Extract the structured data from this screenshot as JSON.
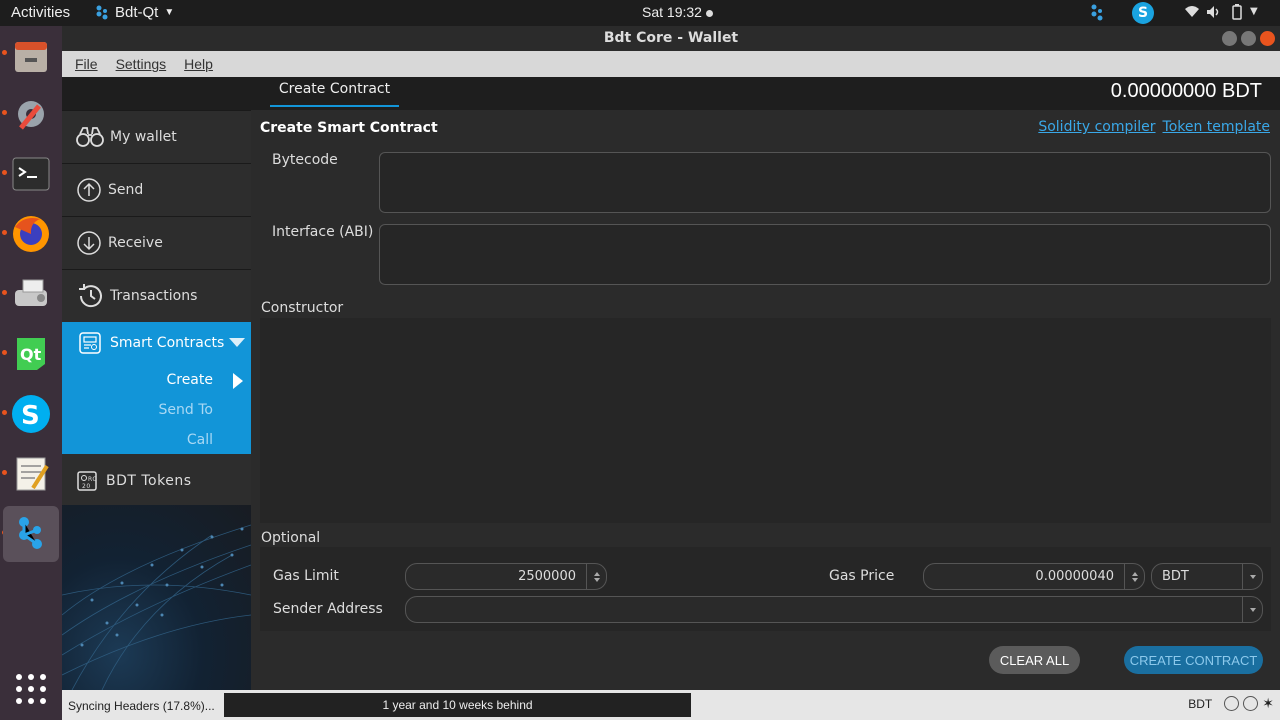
{
  "topbar": {
    "activities": "Activities",
    "app_menu": "Bdt-Qt",
    "clock": "Sat 19:32"
  },
  "window": {
    "title": "Bdt Core - Wallet"
  },
  "menubar": {
    "file": "File",
    "settings": "Settings",
    "help": "Help"
  },
  "sidebar": {
    "my_wallet": "My wallet",
    "send": "Send",
    "receive": "Receive",
    "transactions": "Transactions",
    "smart_contracts": "Smart Contracts",
    "sub_create": "Create",
    "sub_send_to": "Send To",
    "sub_call": "Call",
    "tokens": "BDT  Tokens"
  },
  "main": {
    "tab": "Create Contract",
    "balance": "0.00000000 BDT",
    "heading": "Create Smart Contract",
    "link_compiler": "Solidity compiler",
    "link_template": "Token template",
    "bytecode_label": "Bytecode",
    "abi_label": "Interface (ABI)",
    "constructor_label": "Constructor",
    "optional_label": "Optional",
    "gas_limit_label": "Gas Limit",
    "gas_limit_value": "2500000",
    "gas_price_label": "Gas Price",
    "gas_price_value": "0.00000040",
    "gas_unit": "BDT",
    "sender_label": "Sender Address",
    "clear_all": "CLEAR ALL",
    "create_contract": "CREATE CONTRACT"
  },
  "statusbar": {
    "syncing": "Syncing Headers (17.8%)...",
    "behind": "1 year and 10 weeks behind",
    "unit": "BDT"
  },
  "colors": {
    "accent": "#1295d8",
    "link": "#3aa8e8",
    "ubuntu_orange": "#e9541e"
  }
}
